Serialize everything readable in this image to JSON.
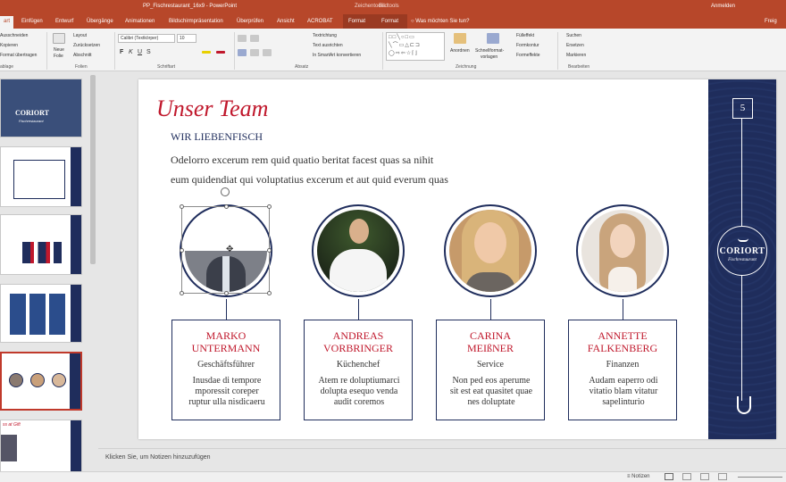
{
  "window": {
    "title": "PP_Fischrestaurant_16x9 - PowerPoint",
    "context_group_1": "Zeichentools",
    "context_group_2": "Bildtools",
    "signin": "Anmelden",
    "share": "Freig"
  },
  "tabs": [
    "art",
    "Einfügen",
    "Entwurf",
    "Übergänge",
    "Animationen",
    "Bildschirmpräsentation",
    "Überprüfen",
    "Ansicht",
    "ACROBAT",
    "Format",
    "Format",
    "Was möchten Sie tun?"
  ],
  "ribbon": {
    "clipboard": {
      "cut": "Ausschneiden",
      "copy": "Kopieren",
      "format": "Format übertragen",
      "label": "ablage"
    },
    "slides": {
      "new": "Neue",
      "new2": "Folie",
      "layout": "Layout",
      "reset": "Zurücksetzen",
      "section": "Abschnitt",
      "label": "Folien"
    },
    "font": {
      "name": "Calibri (Textkörper)",
      "size": "10",
      "label": "Schriftart"
    },
    "paragraph": {
      "direction": "Textrichtung",
      "align": "Text ausrichten",
      "smartart": "In SmartArt konvertieren",
      "label": "Absatz"
    },
    "drawing": {
      "arrange": "Anordnen",
      "quick": "Schnellformat-",
      "quick2": "vorlagen",
      "fill": "Fülleffekt",
      "outline": "Formkontur",
      "effects": "Formeffekte",
      "label": "Zeichnung"
    },
    "editing": {
      "find": "Suchen",
      "replace": "Ersetzen",
      "select": "Markieren",
      "label": "Bearbeiten"
    }
  },
  "thumbnails": {
    "brand": "CORIORT",
    "brand_sub": "Fischrestaurant",
    "last_title": "ss at Gift"
  },
  "slide": {
    "title": "Unser Team",
    "subtitle": "WIR LIEBENFISCH",
    "body_line1": "Odelorro excerum rem quid quatio beritat facest quas sa nihit",
    "body_line2": "eum quidendiat qui voluptatius excerum et aut quid everum quas",
    "page_number": "5",
    "logo_name": "CORIORT",
    "logo_sub": "Fischrestaurant",
    "members": [
      {
        "name1": "MARKO",
        "name2": "UNTERMANN",
        "role": "Geschäftsführer",
        "d1": "Inusdae di tempore",
        "d2": "mporessit coreper",
        "d3": "ruptur ulla nisdicaeru",
        "photo": "man-suit-photo"
      },
      {
        "name1": "ANDREAS",
        "name2": "VORBRINGER",
        "role": "Küchenchef",
        "d1": "Atem re doluptiumarci",
        "d2": "dolupta esequo venda",
        "d3": "audit coremos",
        "photo": "chef-photo"
      },
      {
        "name1": "CARINA",
        "name2": "MEIßNER",
        "role": "Service",
        "d1": "Non ped eos aperume",
        "d2": "sit est eat quasitet quae",
        "d3": "nes doluptate",
        "photo": "woman-smiling-photo"
      },
      {
        "name1": "ANNETTE",
        "name2": "FALKENBERG",
        "role": "Finanzen",
        "d1": "Audam eaperro odi",
        "d2": "vitatio blam vitatur",
        "d3": "sapelinturio",
        "photo": "woman-long-hair-photo"
      }
    ]
  },
  "notes_placeholder": "Klicken Sie, um Notizen hinzuzufügen",
  "status": {
    "notes_btn": "Notizen"
  },
  "colors": {
    "accent_red": "#c0182c",
    "navy": "#1f2d5c",
    "app_bar": "#b7472a"
  }
}
